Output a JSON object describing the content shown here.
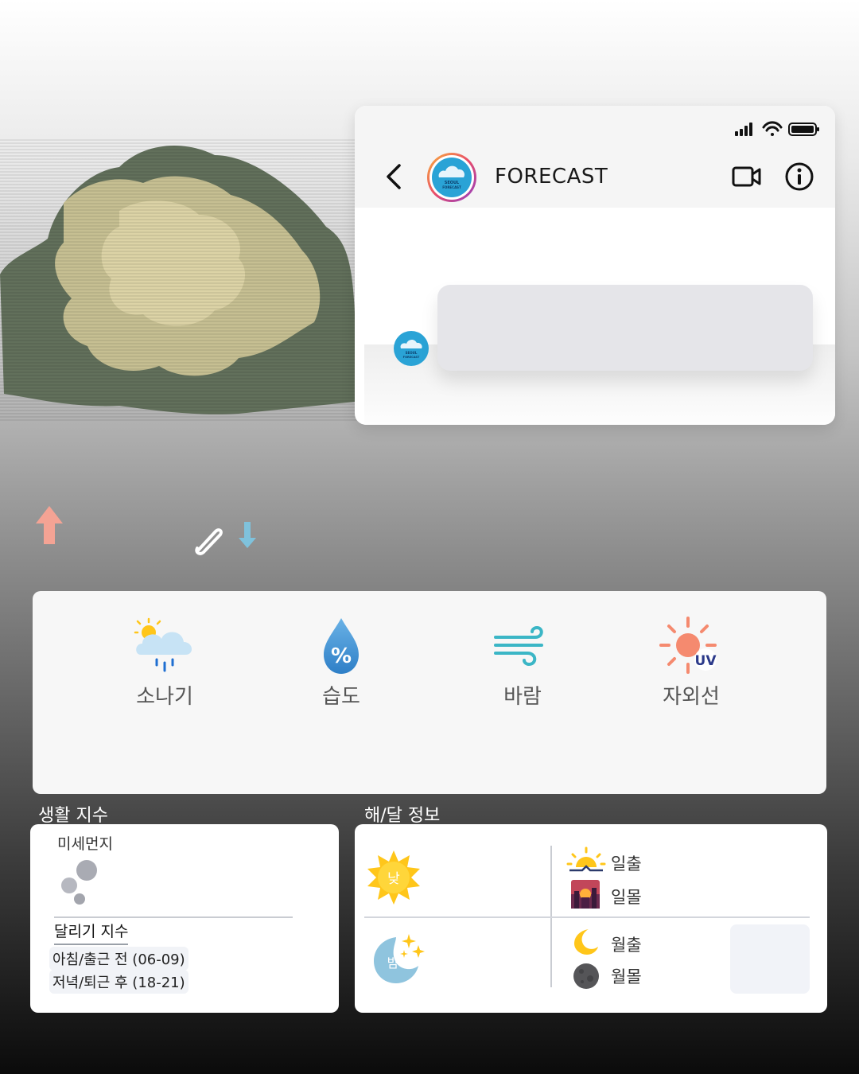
{
  "chat": {
    "title": "FORECAST",
    "avatar_text_line1": "SEOUL",
    "avatar_text_line2": "FORECAST"
  },
  "weather_items": [
    {
      "label": "소나기",
      "icon": "rain-shower-icon"
    },
    {
      "label": "습도",
      "icon": "humidity-drop-icon"
    },
    {
      "label": "바람",
      "icon": "wind-icon"
    },
    {
      "label": "자외선",
      "icon": "uv-sun-icon"
    }
  ],
  "uv_badge": "UV",
  "humidity_symbol": "%",
  "life_index": {
    "title": "생활 지수",
    "fine_dust": "미세먼지",
    "running_title": "달리기 지수",
    "morning": "아침/출근 전 (06-09)",
    "evening": "저녁/퇴근 후 (18-21)"
  },
  "sun_moon": {
    "title": "해/달 정보",
    "day": "낮",
    "night": "밤",
    "sunrise": "일출",
    "sunset": "일몰",
    "moonrise": "월출",
    "moonset": "월몰"
  },
  "colors": {
    "up_arrow": "#f4a394",
    "down_arrow": "#7fc2dc",
    "sun_yellow": "#ffc61a",
    "moon_blue": "#8fc4de"
  }
}
